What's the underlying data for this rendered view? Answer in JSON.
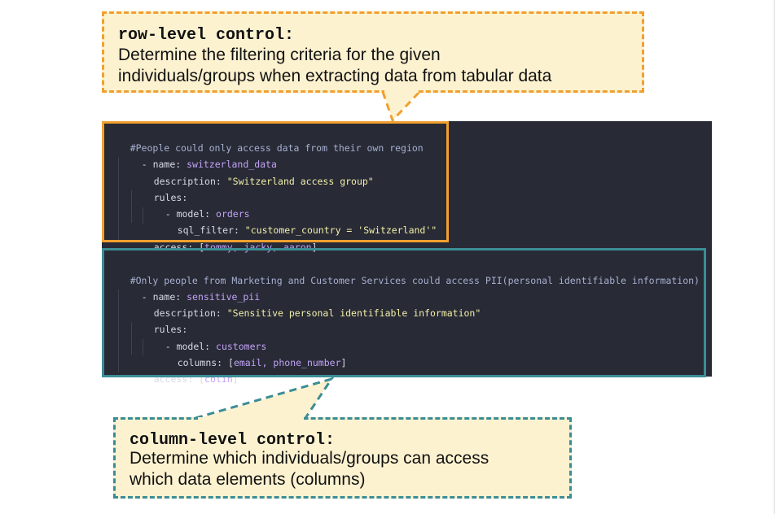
{
  "callouts": {
    "row_level": {
      "title": "row-level control:",
      "body": "Determine the filtering criteria for the given\nindividuals/groups when extracting data from tabular data"
    },
    "column_level": {
      "title": "column-level control:",
      "body": "Determine  which individuals/groups can access\nwhich data elements (columns)"
    }
  },
  "code": {
    "block1": {
      "comment": "#People could only access data from their own region",
      "name_key": "name: ",
      "name_val": "switzerland_data",
      "desc_key": "description: ",
      "desc_val": "\"Switzerland access group\"",
      "rules_key": "rules:",
      "model_key": "model: ",
      "model_val": "orders",
      "filter_key": "sql_filter: ",
      "filter_val": "\"customer_country = 'Switzerland'\"",
      "access_key": "access: ",
      "access_val": "tommy, jacky, aaron"
    },
    "block2": {
      "comment": "#Only people from Marketing and Customer Services could access PII(personal identifiable information)",
      "name_key": "name: ",
      "name_val": "sensitive_pii",
      "desc_key": "description: ",
      "desc_val": "\"Sensitive personal identifiable information\"",
      "rules_key": "rules:",
      "model_key": "model: ",
      "model_val": "customers",
      "columns_key": "columns: ",
      "columns_val": "email, phone_number",
      "access_key": "access: ",
      "access_val": "colin"
    }
  },
  "colors": {
    "orange": "#f0a02e",
    "teal": "#3b8d95",
    "callout_fill": "#fdf2d0",
    "code_bg": "#282a36"
  }
}
